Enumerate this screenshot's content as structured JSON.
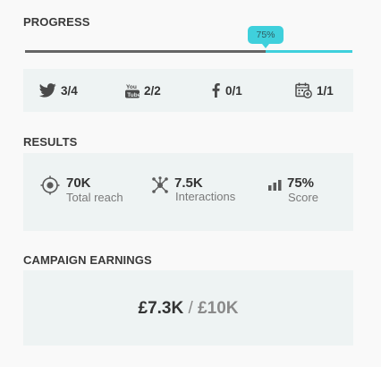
{
  "progress": {
    "title": "PROGRESS",
    "percent_label": "75%",
    "percent": 75
  },
  "channels": [
    {
      "icon": "twitter-icon",
      "value": "3/4"
    },
    {
      "icon": "youtube-icon",
      "value": "2/2"
    },
    {
      "icon": "facebook-icon",
      "value": "0/1"
    },
    {
      "icon": "calendar-icon",
      "value": "1/1"
    }
  ],
  "results": {
    "title": "RESULTS",
    "items": [
      {
        "icon": "reach-target-icon",
        "value": "70K",
        "label": "Total reach"
      },
      {
        "icon": "interactions-icon",
        "value": "7.5K",
        "label": "Interactions"
      },
      {
        "icon": "score-bars-icon",
        "value": "75%",
        "label": "Score"
      }
    ]
  },
  "earnings": {
    "title": "CAMPAIGN EARNINGS",
    "current": "£7.3K",
    "separator": "/",
    "goal": "£10K"
  },
  "colors": {
    "accent": "#3fd0dc",
    "panel": "#eef3f3",
    "progress_done": "#666666"
  }
}
